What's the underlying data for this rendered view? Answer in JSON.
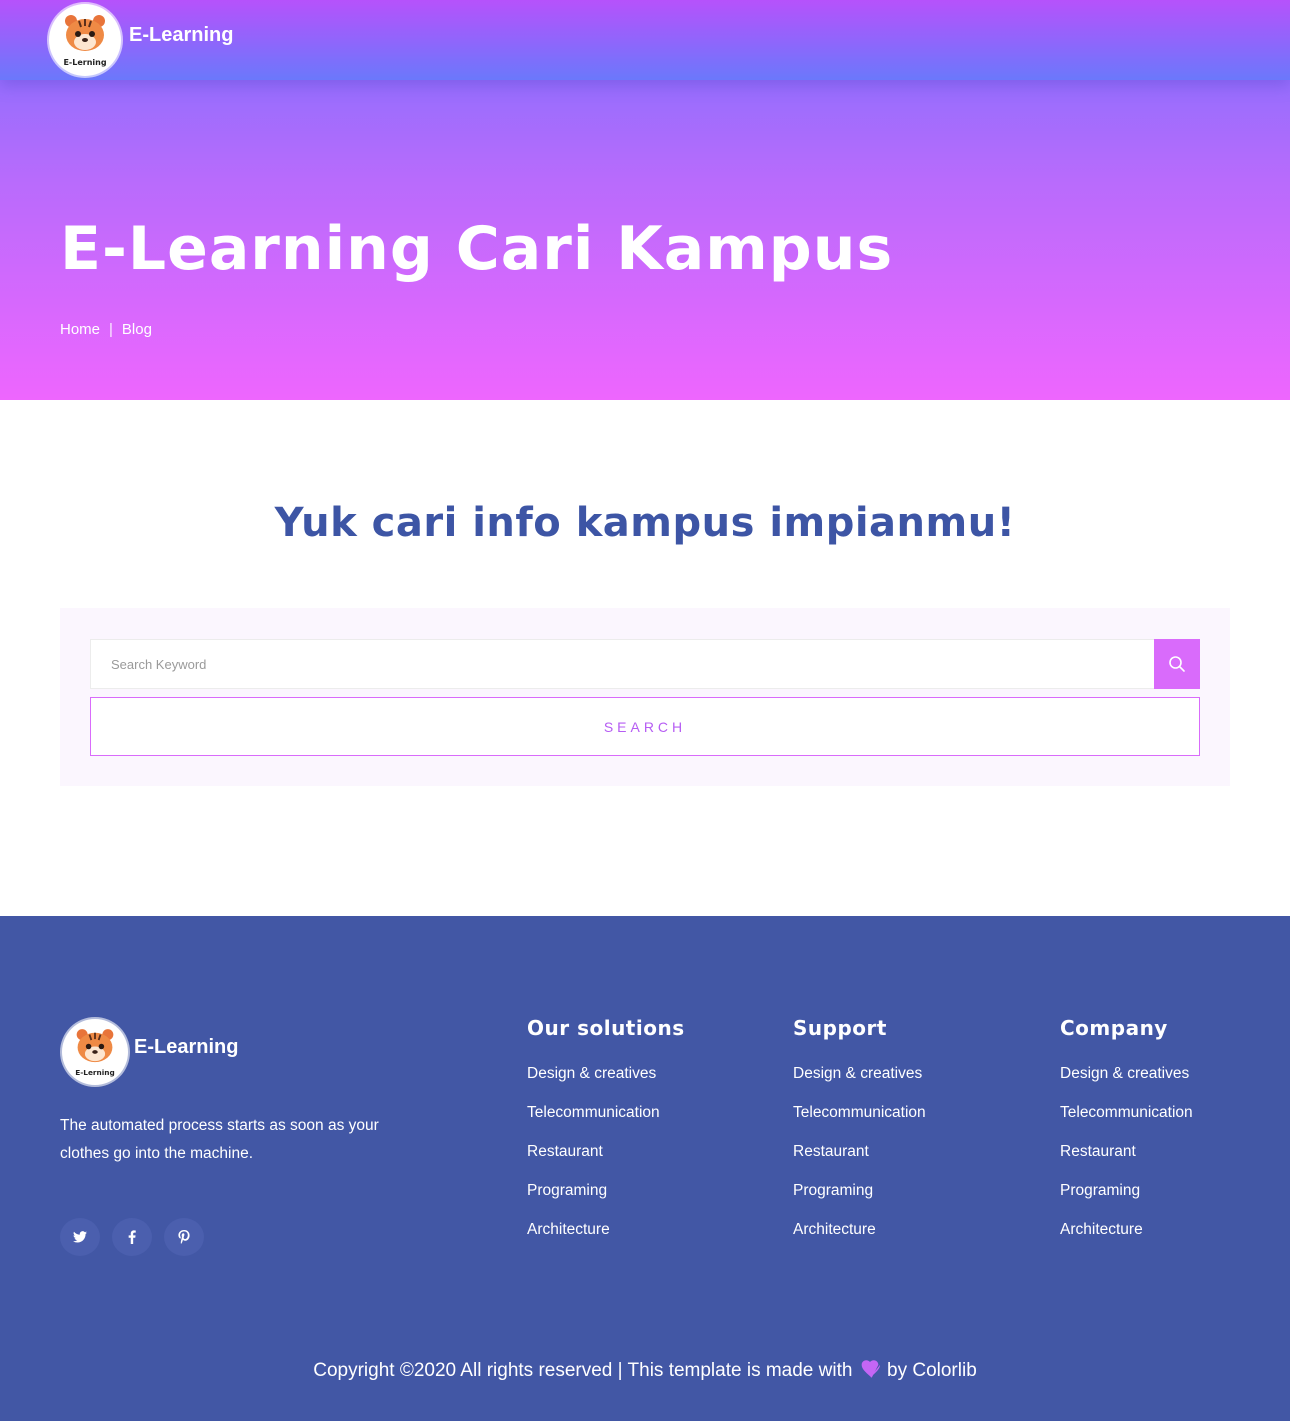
{
  "header": {
    "brand": "E-Learning",
    "logo_text": "E-Lerning"
  },
  "hero": {
    "title": "E-Learning Cari Kampus",
    "breadcrumb": {
      "home": "Home",
      "separator": "|",
      "current": "Blog"
    }
  },
  "search": {
    "heading": "Yuk cari info kampus impianmu!",
    "placeholder": "Search Keyword",
    "button_label": "SEARCH",
    "icon": "search-icon"
  },
  "footer": {
    "brand": "E-Learning",
    "logo_text": "E-Lerning",
    "description": "The automated process starts as soon as your clothes go into the machine.",
    "socials": [
      "twitter-icon",
      "facebook-icon",
      "pinterest-icon"
    ],
    "columns": [
      {
        "title": "Our solutions",
        "links": [
          "Design & creatives",
          "Telecommunication",
          "Restaurant",
          "Programing",
          "Architecture"
        ]
      },
      {
        "title": "Support",
        "links": [
          "Design & creatives",
          "Telecommunication",
          "Restaurant",
          "Programing",
          "Architecture"
        ]
      },
      {
        "title": "Company",
        "links": [
          "Design & creatives",
          "Telecommunication",
          "Restaurant",
          "Programing",
          "Architecture"
        ]
      }
    ],
    "copyright_before": "Copyright ©2020 All rights reserved | This template is made with",
    "copyright_after": "by Colorlib"
  },
  "colors": {
    "header_top": "#b652fb",
    "header_bottom": "#6b78fb",
    "hero_bottom": "#ee66fe",
    "accent": "#d96bfb",
    "heading_blue": "#3d55a5",
    "footer_bg": "#4257a5"
  }
}
